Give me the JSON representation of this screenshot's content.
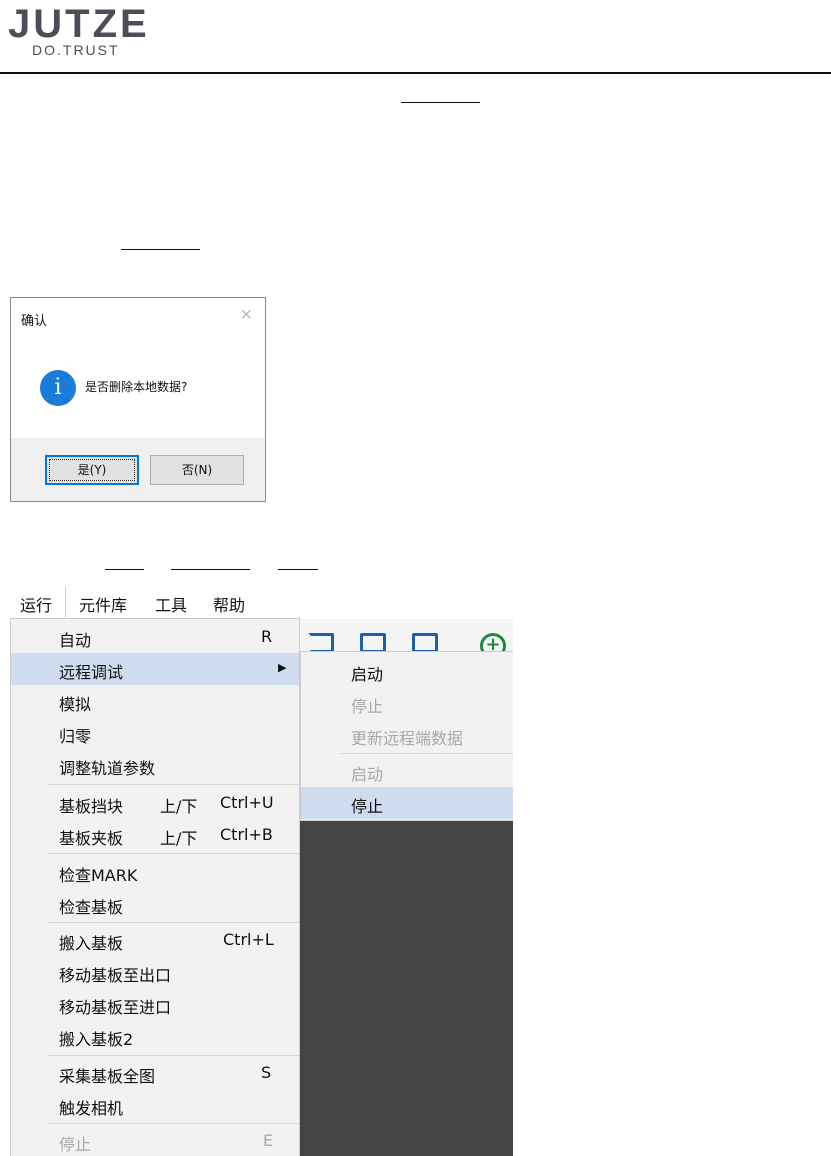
{
  "header": {
    "logo_word": "JUTZE",
    "logo_tagline": "DO.TRUST"
  },
  "dialog": {
    "title": "确认",
    "close_glyph": "✕",
    "icon_glyph": "i",
    "message": "是否删除本地数据?",
    "yes_label": "是(Y)",
    "no_label": "否(N)"
  },
  "menu_screenshot": {
    "menubar": [
      "运行",
      "元件库",
      "工具",
      "帮助"
    ],
    "toolbar_plus_glyph": "+",
    "main_menu": {
      "auto": {
        "label": "自动",
        "key": "R"
      },
      "remote_debug": {
        "label": "远程调试",
        "arrow": "▶"
      },
      "simulate": {
        "label": "模拟"
      },
      "homing": {
        "label": "归零"
      },
      "adjust_rail": {
        "label": "调整轨道参数"
      },
      "board_stopper": {
        "label": "基板挡块",
        "mid": "上/下",
        "key": "Ctrl+U"
      },
      "board_clamp": {
        "label": "基板夹板",
        "mid": "上/下",
        "key": "Ctrl+B"
      },
      "check_mark": {
        "label": "检查MARK"
      },
      "check_board": {
        "label": "检查基板"
      },
      "load_board": {
        "label": "搬入基板",
        "key": "Ctrl+L"
      },
      "move_to_exit": {
        "label": "移动基板至出口"
      },
      "move_to_entry": {
        "label": "移动基板至进口"
      },
      "load_board_2": {
        "label": "搬入基板2"
      },
      "capture_full": {
        "label": "采集基板全图",
        "key": "S"
      },
      "trigger_camera": {
        "label": "触发相机"
      },
      "stop": {
        "label": "停止",
        "key": "E"
      }
    },
    "sub_menu": {
      "start": "启动",
      "stop": "停止",
      "update_remote": "更新远程端数据",
      "start_2": "启动",
      "stop_2": "停止"
    }
  }
}
